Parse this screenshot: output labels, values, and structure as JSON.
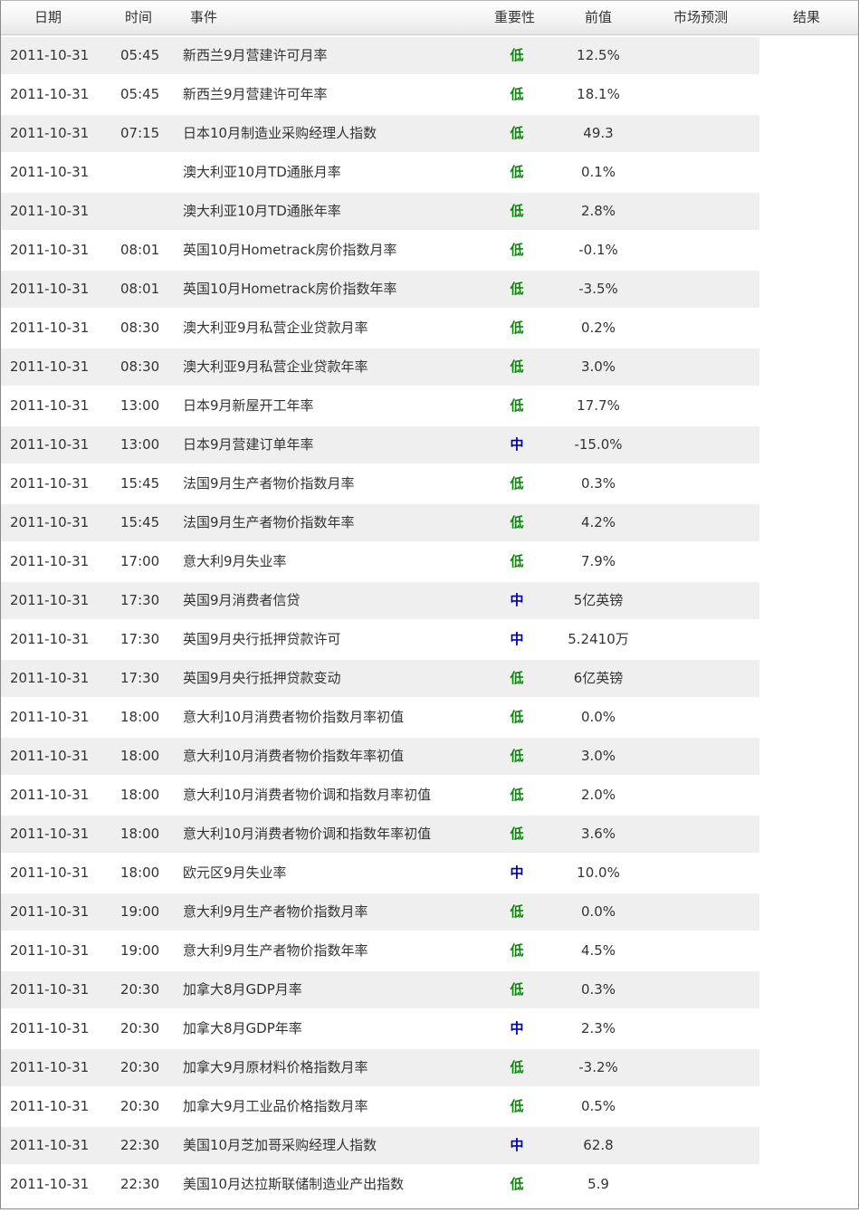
{
  "header": {
    "date": "日期",
    "time": "时间",
    "event": "事件",
    "importance": "重要性",
    "previous": "前值",
    "forecast": "市场预测",
    "result": "结果"
  },
  "colors": {
    "low": "#0a8a0a",
    "mid": "#0000a0",
    "stripe": "#efefef"
  },
  "rows": [
    {
      "date": "2011-10-31",
      "time": "05:45",
      "event": "新西兰9月营建许可月率",
      "importance": "低",
      "previous": "12.5%",
      "forecast": "",
      "result": ""
    },
    {
      "date": "2011-10-31",
      "time": "05:45",
      "event": "新西兰9月营建许可年率",
      "importance": "低",
      "previous": "18.1%",
      "forecast": "",
      "result": ""
    },
    {
      "date": "2011-10-31",
      "time": "07:15",
      "event": "日本10月制造业采购经理人指数",
      "importance": "低",
      "previous": "49.3",
      "forecast": "",
      "result": ""
    },
    {
      "date": "2011-10-31",
      "time": "",
      "event": "澳大利亚10月TD通胀月率",
      "importance": "低",
      "previous": "0.1%",
      "forecast": "",
      "result": ""
    },
    {
      "date": "2011-10-31",
      "time": "",
      "event": "澳大利亚10月TD通胀年率",
      "importance": "低",
      "previous": "2.8%",
      "forecast": "",
      "result": ""
    },
    {
      "date": "2011-10-31",
      "time": "08:01",
      "event": "英国10月Hometrack房价指数月率",
      "importance": "低",
      "previous": "-0.1%",
      "forecast": "",
      "result": ""
    },
    {
      "date": "2011-10-31",
      "time": "08:01",
      "event": "英国10月Hometrack房价指数年率",
      "importance": "低",
      "previous": "-3.5%",
      "forecast": "",
      "result": ""
    },
    {
      "date": "2011-10-31",
      "time": "08:30",
      "event": "澳大利亚9月私营企业贷款月率",
      "importance": "低",
      "previous": "0.2%",
      "forecast": "",
      "result": ""
    },
    {
      "date": "2011-10-31",
      "time": "08:30",
      "event": "澳大利亚9月私营企业贷款年率",
      "importance": "低",
      "previous": "3.0%",
      "forecast": "",
      "result": ""
    },
    {
      "date": "2011-10-31",
      "time": "13:00",
      "event": "日本9月新屋开工年率",
      "importance": "低",
      "previous": "17.7%",
      "forecast": "",
      "result": ""
    },
    {
      "date": "2011-10-31",
      "time": "13:00",
      "event": "日本9月营建订单年率",
      "importance": "中",
      "previous": "-15.0%",
      "forecast": "",
      "result": ""
    },
    {
      "date": "2011-10-31",
      "time": "15:45",
      "event": "法国9月生产者物价指数月率",
      "importance": "低",
      "previous": "0.3%",
      "forecast": "",
      "result": ""
    },
    {
      "date": "2011-10-31",
      "time": "15:45",
      "event": "法国9月生产者物价指数年率",
      "importance": "低",
      "previous": "4.2%",
      "forecast": "",
      "result": ""
    },
    {
      "date": "2011-10-31",
      "time": "17:00",
      "event": "意大利9月失业率",
      "importance": "低",
      "previous": "7.9%",
      "forecast": "",
      "result": ""
    },
    {
      "date": "2011-10-31",
      "time": "17:30",
      "event": "英国9月消费者信贷",
      "importance": "中",
      "previous": "5亿英镑",
      "forecast": "",
      "result": ""
    },
    {
      "date": "2011-10-31",
      "time": "17:30",
      "event": "英国9月央行抵押贷款许可",
      "importance": "中",
      "previous": "5.2410万",
      "forecast": "",
      "result": ""
    },
    {
      "date": "2011-10-31",
      "time": "17:30",
      "event": "英国9月央行抵押贷款变动",
      "importance": "低",
      "previous": "6亿英镑",
      "forecast": "",
      "result": ""
    },
    {
      "date": "2011-10-31",
      "time": "18:00",
      "event": "意大利10月消费者物价指数月率初值",
      "importance": "低",
      "previous": "0.0%",
      "forecast": "",
      "result": ""
    },
    {
      "date": "2011-10-31",
      "time": "18:00",
      "event": "意大利10月消费者物价指数年率初值",
      "importance": "低",
      "previous": "3.0%",
      "forecast": "",
      "result": ""
    },
    {
      "date": "2011-10-31",
      "time": "18:00",
      "event": "意大利10月消费者物价调和指数月率初值",
      "importance": "低",
      "previous": "2.0%",
      "forecast": "",
      "result": ""
    },
    {
      "date": "2011-10-31",
      "time": "18:00",
      "event": "意大利10月消费者物价调和指数年率初值",
      "importance": "低",
      "previous": "3.6%",
      "forecast": "",
      "result": ""
    },
    {
      "date": "2011-10-31",
      "time": "18:00",
      "event": "欧元区9月失业率",
      "importance": "中",
      "previous": "10.0%",
      "forecast": "",
      "result": ""
    },
    {
      "date": "2011-10-31",
      "time": "19:00",
      "event": "意大利9月生产者物价指数月率",
      "importance": "低",
      "previous": "0.0%",
      "forecast": "",
      "result": ""
    },
    {
      "date": "2011-10-31",
      "time": "19:00",
      "event": "意大利9月生产者物价指数年率",
      "importance": "低",
      "previous": "4.5%",
      "forecast": "",
      "result": ""
    },
    {
      "date": "2011-10-31",
      "time": "20:30",
      "event": "加拿大8月GDP月率",
      "importance": "低",
      "previous": "0.3%",
      "forecast": "",
      "result": ""
    },
    {
      "date": "2011-10-31",
      "time": "20:30",
      "event": "加拿大8月GDP年率",
      "importance": "中",
      "previous": "2.3%",
      "forecast": "",
      "result": ""
    },
    {
      "date": "2011-10-31",
      "time": "20:30",
      "event": "加拿大9月原材料价格指数月率",
      "importance": "低",
      "previous": "-3.2%",
      "forecast": "",
      "result": ""
    },
    {
      "date": "2011-10-31",
      "time": "20:30",
      "event": "加拿大9月工业品价格指数月率",
      "importance": "低",
      "previous": "0.5%",
      "forecast": "",
      "result": ""
    },
    {
      "date": "2011-10-31",
      "time": "22:30",
      "event": "美国10月芝加哥采购经理人指数",
      "importance": "中",
      "previous": "62.8",
      "forecast": "",
      "result": ""
    },
    {
      "date": "2011-10-31",
      "time": "22:30",
      "event": "美国10月达拉斯联储制造业产出指数",
      "importance": "低",
      "previous": "5.9",
      "forecast": "",
      "result": ""
    }
  ]
}
